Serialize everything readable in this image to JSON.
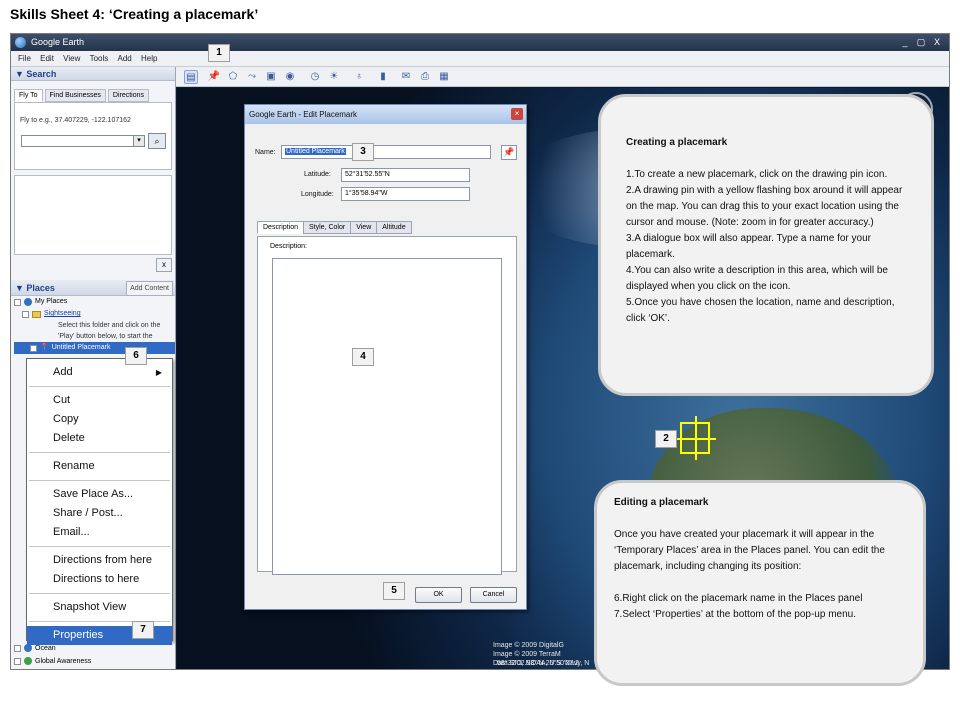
{
  "sheet_title": "Skills Sheet 4: ‘Creating a placemark’",
  "app": {
    "window_title": "Google Earth",
    "window_buttons": [
      "_",
      "▢",
      "X"
    ],
    "menu": [
      "File",
      "Edit",
      "View",
      "Tools",
      "Add",
      "Help"
    ]
  },
  "search_panel": {
    "header": "▼ Search",
    "tabs": [
      "Fly To",
      "Find Businesses",
      "Directions"
    ],
    "fly_to_hint": "Fly to e.g., 37.407229, -122.107162",
    "fly_to_value": "",
    "close_label": "x"
  },
  "places_panel": {
    "header": "▼ Places",
    "add_content": "Add Content",
    "my_places": "My Places",
    "sightseeing": "Sightseeing",
    "hint_line1": "Select this folder and click on the",
    "hint_line2": "'Play' button below, to start the",
    "untitled": "Untitled Placemark",
    "layers": [
      "Ocean",
      "Global Awareness"
    ]
  },
  "context_menu": {
    "items": [
      "Add",
      "Cut",
      "Copy",
      "Delete",
      "Rename",
      "Save Place As...",
      "Share / Post...",
      "Email...",
      "Directions from here",
      "Directions to here",
      "Snapshot View",
      "Properties"
    ],
    "selected": "Properties"
  },
  "dialog": {
    "title": "Google Earth - Edit Placemark",
    "name_label": "Name:",
    "name_value": "Untitled Placemark",
    "latitude_label": "Latitude:",
    "latitude_value": "52°31'52.55\"N",
    "longitude_label": "Longitude:",
    "longitude_value": "1°35'58.94\"W",
    "tabs": [
      "Description",
      "Style, Color",
      "View",
      "Altitude"
    ],
    "active_tab": "Description",
    "description_label": "Description:",
    "description_value": "",
    "ok_label": "OK",
    "cancel_label": "Cancel"
  },
  "map": {
    "copyright_lines": [
      "Image © 2009 DigitalG",
      "Image © 2009 TerraM",
      "Data SIO, NOAA, U.S. Navy, N"
    ],
    "coordinates": "58°32'02.93\" N     26°50'27.2"
  },
  "numbers": [
    "1",
    "2",
    "3",
    "4",
    "5",
    "6",
    "7"
  ],
  "callout_create": {
    "title": "Creating a placemark",
    "lines": [
      "1.To create a new placemark, click on the drawing pin icon.",
      "2.A drawing pin with a yellow flashing box around it will appear on the map. You can drag this to your exact location using the cursor and mouse.  (Note: zoom in for greater accuracy.)",
      "3.A dialogue box will also appear. Type a name for your placemark.",
      "4.You can also write a description in this area, which will be displayed when you click on the icon.",
      "5.Once you have chosen the location, name and description, click ‘OK’."
    ]
  },
  "callout_edit": {
    "title": "Editing a placemark",
    "intro": "Once you have created your placemark it will appear in the ‘Temporary Places’ area in the Places panel. You can edit the placemark, including changing its position:",
    "lines": [
      "6.Right click on the placemark name in the Places panel",
      "7.Select ‘Properties’ at the bottom of the pop-up menu."
    ]
  },
  "colors": {
    "accent": "#316ac5",
    "pin_box": "#ffff00",
    "callout_bg": "#f2f2f2"
  }
}
